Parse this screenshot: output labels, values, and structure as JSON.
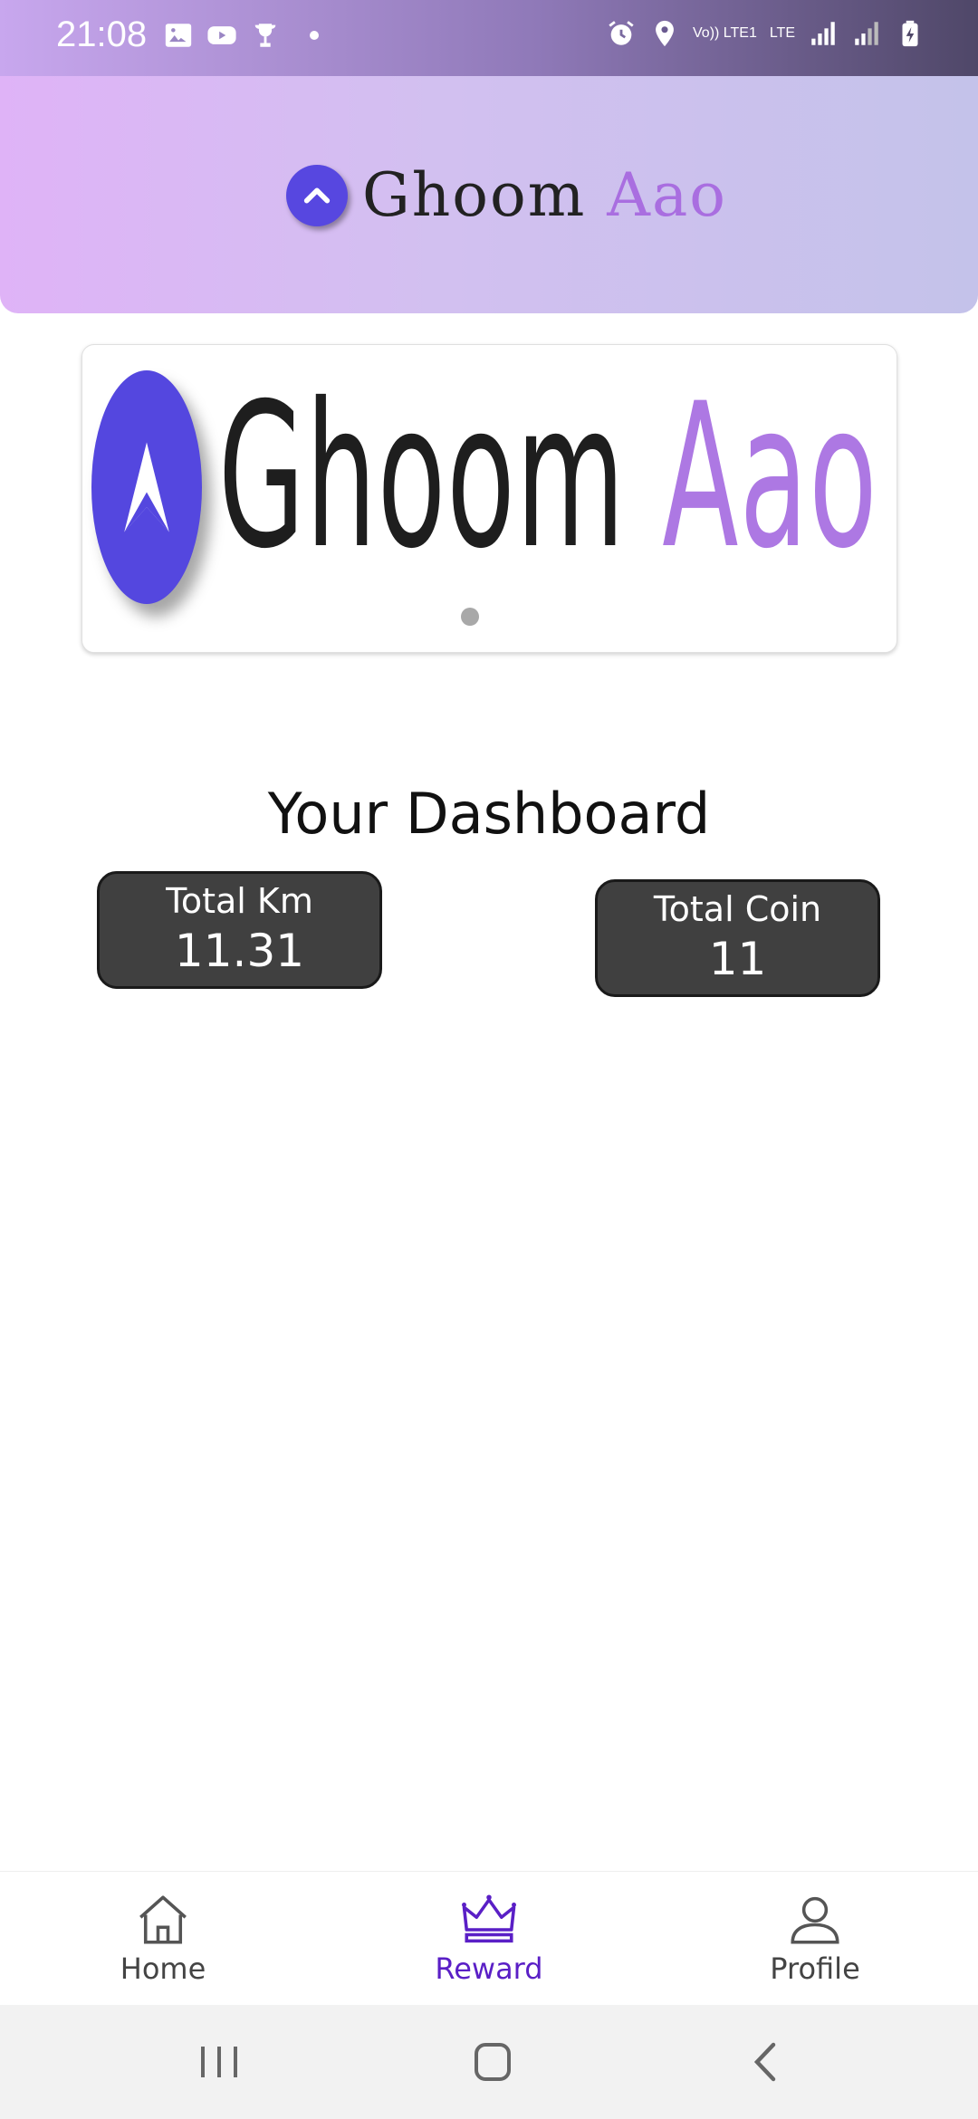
{
  "status_bar": {
    "time": "21:08",
    "left_icons": [
      "gallery-icon",
      "youtube-icon",
      "trophy-icon",
      "dot-icon"
    ],
    "right_icons": [
      "alarm-icon",
      "location-icon",
      "volte-icon",
      "lte-icon",
      "signal-icon",
      "signal-icon-2",
      "battery-charging-icon"
    ],
    "volte_text": "Vo)) LTE1",
    "lte_text": "LTE"
  },
  "header": {
    "title_part1": "Ghoom",
    "title_part2": "Aao"
  },
  "carousel": {
    "title_part1": "Ghoom",
    "title_part2": "Aao",
    "active_index": 0,
    "count": 1
  },
  "dashboard": {
    "title": "Your Dashboard",
    "total_km_label": "Total Km",
    "total_km_value": "11.31",
    "total_coin_label": "Total Coin",
    "total_coin_value": "11"
  },
  "bottom_nav": {
    "items": [
      {
        "label": "Home",
        "icon": "home-icon",
        "active": false
      },
      {
        "label": "Reward",
        "icon": "crown-icon",
        "active": true
      },
      {
        "label": "Profile",
        "icon": "profile-icon",
        "active": false
      }
    ]
  },
  "colors": {
    "accent": "#5a1fc6",
    "brand_blue": "#5447df",
    "brand_purple": "#ad78e3",
    "stat_bg": "#404040"
  }
}
